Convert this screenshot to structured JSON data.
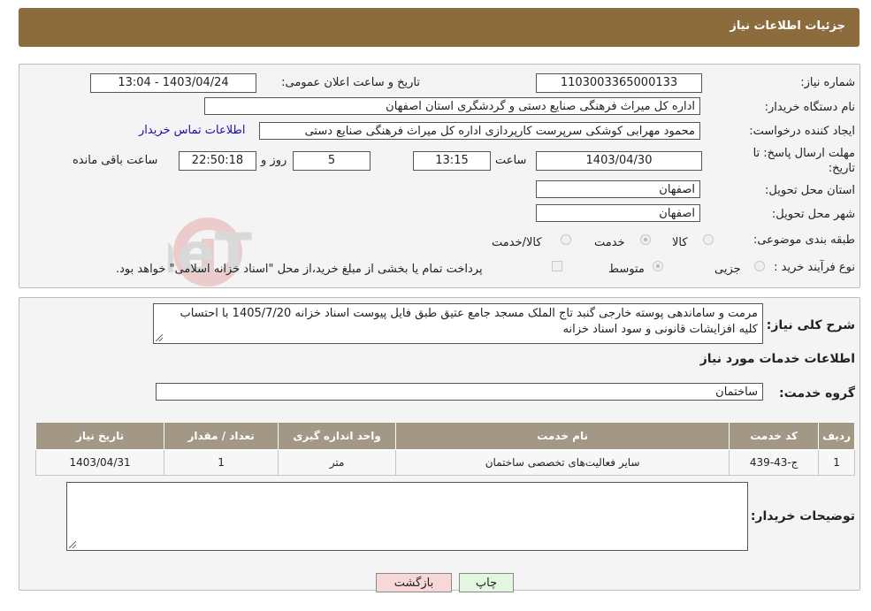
{
  "header": {
    "title": "جزئیات اطلاعات نیاز"
  },
  "details": {
    "need_number_label": "شماره نیاز:",
    "need_number": "1103003365000133",
    "announce_label": "تاریخ و ساعت اعلان عمومی:",
    "announce_value": "1403/04/24 - 13:04",
    "buyer_org_label": "نام دستگاه خریدار:",
    "buyer_org": "اداره کل میراث فرهنگی  صنایع دستی و گردشگری استان اصفهان",
    "requester_label": "ایجاد کننده درخواست:",
    "requester": "محمود مهرابی کوشکی سرپرست کارپردازی اداره کل میراث فرهنگی  صنایع دستی",
    "contact_link": "اطلاعات تماس خریدار",
    "deadline_label_1": "مهلت ارسال پاسخ: تا",
    "deadline_label_2": "تاریخ:",
    "deadline_date": "1403/04/30",
    "time_label": "ساعت",
    "deadline_time": "13:15",
    "days_value": "5",
    "days_label": "روز و",
    "remaining_time": "22:50:18",
    "remaining_label": "ساعت باقی مانده",
    "province_label": "استان محل تحویل:",
    "province": "اصفهان",
    "city_label": "شهر محل تحویل:",
    "city": "اصفهان",
    "category_label": "طبقه بندی موضوعی:",
    "category_options": [
      "کالا",
      "خدمت",
      "کالا/خدمت"
    ],
    "category_selected": "خدمت",
    "purchase_type_label": "نوع فرآیند خرید :",
    "purchase_options": [
      "جزیی",
      "متوسط"
    ],
    "purchase_selected": "متوسط",
    "payment_note": "پرداخت تمام یا بخشی از مبلغ خرید،از محل \"اسناد خزانه اسلامی\" خواهد بود."
  },
  "description": {
    "label": "شرح کلی نیاز:",
    "text": "مرمت و ساماندهی پوسته خارجی گنبد تاج الملک مسجد جامع عتیق طبق فایل پیوست اسناد خزانه 1405/7/20 با احتساب کلیه افزایشات قانونی و سود اسناد خزانه"
  },
  "services": {
    "section_title": "اطلاعات خدمات مورد نیاز",
    "group_label": "گروه خدمت:",
    "group_value": "ساختمان",
    "columns": [
      "ردیف",
      "کد خدمت",
      "نام خدمت",
      "واحد اندازه گیری",
      "تعداد / مقدار",
      "تاریخ نیاز"
    ],
    "rows": [
      [
        "1",
        "ج-43-439",
        "سایر فعالیت‌های تخصصی ساختمان",
        "متر",
        "1",
        "1403/04/31"
      ]
    ]
  },
  "buyer_notes": {
    "label": "توضیحات خریدار:",
    "value": ""
  },
  "buttons": {
    "print": "چاپ",
    "back": "بازگشت"
  },
  "watermark": {
    "text": "AriaTender.neT"
  },
  "colors": {
    "header_bg": "#8c6b3c",
    "table_header_bg": "#a39785",
    "back_button_bg": "#f8d7d7",
    "print_button_bg": "#e3f6df"
  }
}
